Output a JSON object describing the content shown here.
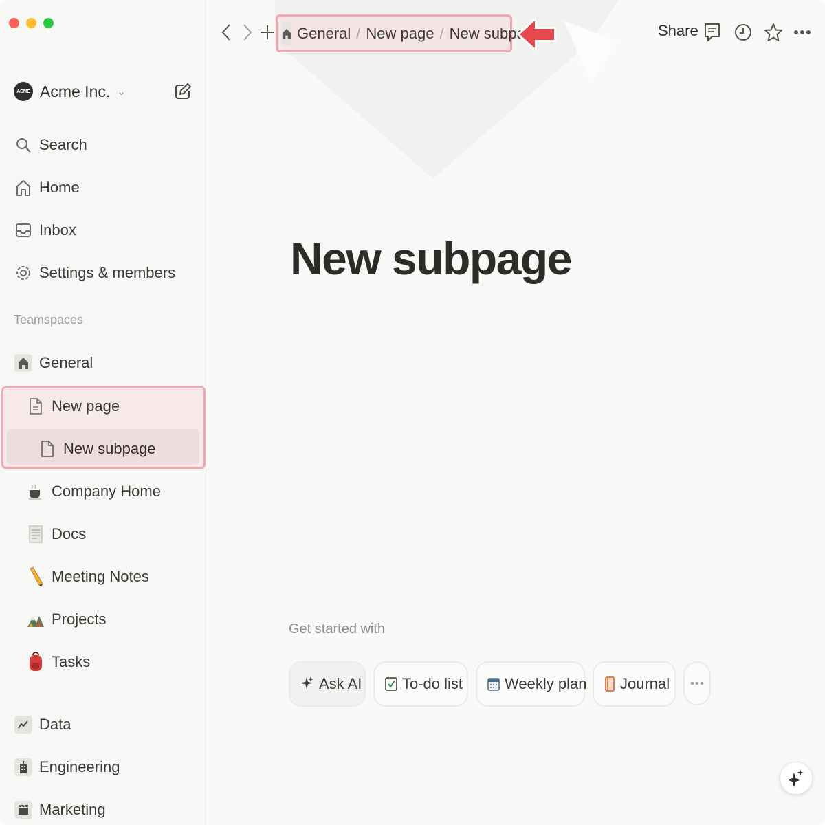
{
  "sidebar": {
    "workspace": {
      "logo_text": "ACME",
      "name": "Acme Inc."
    },
    "nav": [
      {
        "label": "Search",
        "icon": "search-icon"
      },
      {
        "label": "Home",
        "icon": "home-icon"
      },
      {
        "label": "Inbox",
        "icon": "inbox-icon"
      },
      {
        "label": "Settings & members",
        "icon": "gear-icon"
      }
    ],
    "teamspaces_label": "Teamspaces",
    "tree": [
      {
        "label": "General",
        "icon": "house-icon"
      },
      {
        "label": "New page",
        "icon": "page-icon"
      },
      {
        "label": "New subpage",
        "icon": "page-icon"
      },
      {
        "label": "Company Home",
        "icon": "coffee-icon"
      },
      {
        "label": "Docs",
        "icon": "document-icon"
      },
      {
        "label": "Meeting Notes",
        "icon": "pencil-icon"
      },
      {
        "label": "Projects",
        "icon": "mountain-icon"
      },
      {
        "label": "Tasks",
        "icon": "backpack-icon"
      }
    ],
    "teams": [
      {
        "label": "Data",
        "icon": "chart-icon"
      },
      {
        "label": "Engineering",
        "icon": "building-icon"
      },
      {
        "label": "Marketing",
        "icon": "clapper-icon"
      }
    ]
  },
  "topbar": {
    "breadcrumb": [
      "General",
      "New page",
      "New subpage"
    ],
    "breadcrumb_sep": "/",
    "share_label": "Share"
  },
  "page": {
    "title": "New subpage",
    "get_started_label": "Get started with",
    "chips": [
      {
        "label": "Ask AI",
        "icon": "sparkle-icon"
      },
      {
        "label": "To-do list",
        "icon": "checkbox-icon"
      },
      {
        "label": "Weekly plan",
        "icon": "calendar-icon"
      },
      {
        "label": "Journal",
        "icon": "notebook-icon"
      }
    ]
  },
  "colors": {
    "highlight_border": "#f3a6ad",
    "callout_arrow": "#e5484d",
    "sidebar_bg": "#f7f7f5"
  }
}
